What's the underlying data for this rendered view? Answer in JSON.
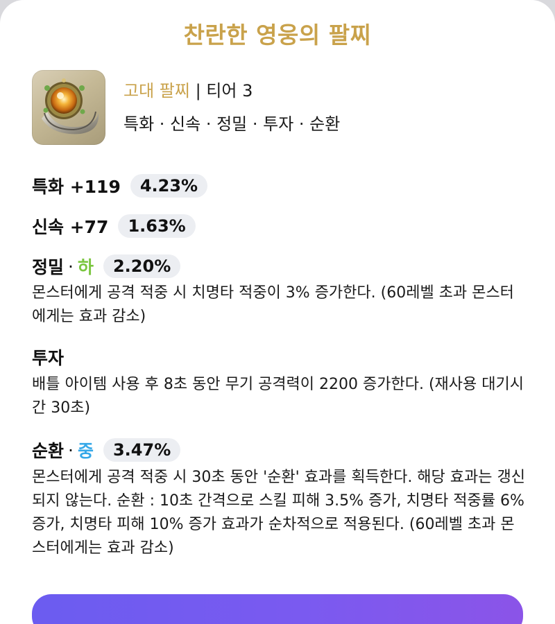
{
  "title": "찬란한 영웅의 팔찌",
  "item": {
    "icon": "ancient-bracelet-icon",
    "grade": "고대 팔찌",
    "separator": " | ",
    "tier": "티어 3",
    "stat_list": "특화 · 신속 · 정밀 · 투자 · 순환"
  },
  "stats": [
    {
      "label": "특화 +119",
      "value": "4.23%"
    },
    {
      "label": "신속 +77",
      "value": "1.63%"
    }
  ],
  "effects": [
    {
      "name": "정밀",
      "dot": " · ",
      "grade": "하",
      "grade_color": "#7bc640",
      "value": "2.20%",
      "description": "몬스터에게 공격 적중 시 치명타 적중이 3% 증가한다. (60레벨 초과 몬스터에게는 효과 감소)"
    },
    {
      "name": "투자",
      "description": "배틀 아이템 사용 후 8초 동안 무기 공격력이 2200 증가한다. (재사용 대기시간 30초)"
    },
    {
      "name": "순환",
      "dot": " · ",
      "grade": "중",
      "grade_color": "#35a8e8",
      "value": "3.47%",
      "description": "몬스터에게 공격 적중 시 30초 동안 '순환' 효과를 획득한다. 해당 효과는 갱신되지 않는다. 순환 : 10초 간격으로 스킬 피해 3.5% 증가, 치명타 적중률 6% 증가, 치명타 피해 10% 증가 효과가 순차적으로 적용된다. (60레벨 초과 몬스터에게는 효과 감소)"
    }
  ],
  "colors": {
    "title": "#c9a24b",
    "pill_bg": "#eceef2",
    "button_gradient_start": "#6b5cf0",
    "button_gradient_end": "#8b54e8"
  }
}
